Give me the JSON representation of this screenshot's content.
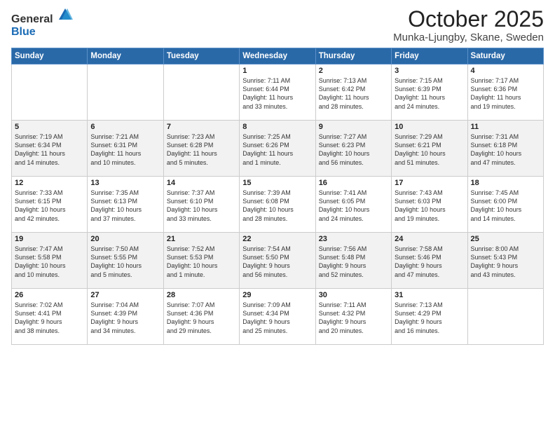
{
  "header": {
    "logo_general": "General",
    "logo_blue": "Blue",
    "title": "October 2025",
    "subtitle": "Munka-Ljungby, Skane, Sweden"
  },
  "days_of_week": [
    "Sunday",
    "Monday",
    "Tuesday",
    "Wednesday",
    "Thursday",
    "Friday",
    "Saturday"
  ],
  "weeks": [
    [
      {
        "day": "",
        "info": ""
      },
      {
        "day": "",
        "info": ""
      },
      {
        "day": "",
        "info": ""
      },
      {
        "day": "1",
        "info": "Sunrise: 7:11 AM\nSunset: 6:44 PM\nDaylight: 11 hours\nand 33 minutes."
      },
      {
        "day": "2",
        "info": "Sunrise: 7:13 AM\nSunset: 6:42 PM\nDaylight: 11 hours\nand 28 minutes."
      },
      {
        "day": "3",
        "info": "Sunrise: 7:15 AM\nSunset: 6:39 PM\nDaylight: 11 hours\nand 24 minutes."
      },
      {
        "day": "4",
        "info": "Sunrise: 7:17 AM\nSunset: 6:36 PM\nDaylight: 11 hours\nand 19 minutes."
      }
    ],
    [
      {
        "day": "5",
        "info": "Sunrise: 7:19 AM\nSunset: 6:34 PM\nDaylight: 11 hours\nand 14 minutes."
      },
      {
        "day": "6",
        "info": "Sunrise: 7:21 AM\nSunset: 6:31 PM\nDaylight: 11 hours\nand 10 minutes."
      },
      {
        "day": "7",
        "info": "Sunrise: 7:23 AM\nSunset: 6:28 PM\nDaylight: 11 hours\nand 5 minutes."
      },
      {
        "day": "8",
        "info": "Sunrise: 7:25 AM\nSunset: 6:26 PM\nDaylight: 11 hours\nand 1 minute."
      },
      {
        "day": "9",
        "info": "Sunrise: 7:27 AM\nSunset: 6:23 PM\nDaylight: 10 hours\nand 56 minutes."
      },
      {
        "day": "10",
        "info": "Sunrise: 7:29 AM\nSunset: 6:21 PM\nDaylight: 10 hours\nand 51 minutes."
      },
      {
        "day": "11",
        "info": "Sunrise: 7:31 AM\nSunset: 6:18 PM\nDaylight: 10 hours\nand 47 minutes."
      }
    ],
    [
      {
        "day": "12",
        "info": "Sunrise: 7:33 AM\nSunset: 6:15 PM\nDaylight: 10 hours\nand 42 minutes."
      },
      {
        "day": "13",
        "info": "Sunrise: 7:35 AM\nSunset: 6:13 PM\nDaylight: 10 hours\nand 37 minutes."
      },
      {
        "day": "14",
        "info": "Sunrise: 7:37 AM\nSunset: 6:10 PM\nDaylight: 10 hours\nand 33 minutes."
      },
      {
        "day": "15",
        "info": "Sunrise: 7:39 AM\nSunset: 6:08 PM\nDaylight: 10 hours\nand 28 minutes."
      },
      {
        "day": "16",
        "info": "Sunrise: 7:41 AM\nSunset: 6:05 PM\nDaylight: 10 hours\nand 24 minutes."
      },
      {
        "day": "17",
        "info": "Sunrise: 7:43 AM\nSunset: 6:03 PM\nDaylight: 10 hours\nand 19 minutes."
      },
      {
        "day": "18",
        "info": "Sunrise: 7:45 AM\nSunset: 6:00 PM\nDaylight: 10 hours\nand 14 minutes."
      }
    ],
    [
      {
        "day": "19",
        "info": "Sunrise: 7:47 AM\nSunset: 5:58 PM\nDaylight: 10 hours\nand 10 minutes."
      },
      {
        "day": "20",
        "info": "Sunrise: 7:50 AM\nSunset: 5:55 PM\nDaylight: 10 hours\nand 5 minutes."
      },
      {
        "day": "21",
        "info": "Sunrise: 7:52 AM\nSunset: 5:53 PM\nDaylight: 10 hours\nand 1 minute."
      },
      {
        "day": "22",
        "info": "Sunrise: 7:54 AM\nSunset: 5:50 PM\nDaylight: 9 hours\nand 56 minutes."
      },
      {
        "day": "23",
        "info": "Sunrise: 7:56 AM\nSunset: 5:48 PM\nDaylight: 9 hours\nand 52 minutes."
      },
      {
        "day": "24",
        "info": "Sunrise: 7:58 AM\nSunset: 5:46 PM\nDaylight: 9 hours\nand 47 minutes."
      },
      {
        "day": "25",
        "info": "Sunrise: 8:00 AM\nSunset: 5:43 PM\nDaylight: 9 hours\nand 43 minutes."
      }
    ],
    [
      {
        "day": "26",
        "info": "Sunrise: 7:02 AM\nSunset: 4:41 PM\nDaylight: 9 hours\nand 38 minutes."
      },
      {
        "day": "27",
        "info": "Sunrise: 7:04 AM\nSunset: 4:39 PM\nDaylight: 9 hours\nand 34 minutes."
      },
      {
        "day": "28",
        "info": "Sunrise: 7:07 AM\nSunset: 4:36 PM\nDaylight: 9 hours\nand 29 minutes."
      },
      {
        "day": "29",
        "info": "Sunrise: 7:09 AM\nSunset: 4:34 PM\nDaylight: 9 hours\nand 25 minutes."
      },
      {
        "day": "30",
        "info": "Sunrise: 7:11 AM\nSunset: 4:32 PM\nDaylight: 9 hours\nand 20 minutes."
      },
      {
        "day": "31",
        "info": "Sunrise: 7:13 AM\nSunset: 4:29 PM\nDaylight: 9 hours\nand 16 minutes."
      },
      {
        "day": "",
        "info": ""
      }
    ]
  ]
}
